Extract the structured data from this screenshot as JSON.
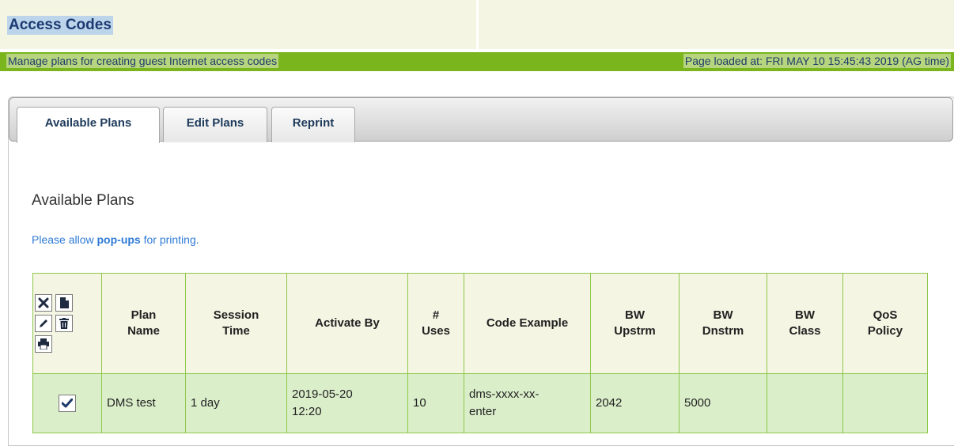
{
  "header": {
    "title": "Access Codes",
    "subtitle": "Manage plans for creating guest Internet access codes",
    "page_loaded": "Page loaded at:  FRI MAY 10 15:45:43 2019  (AG time)",
    "colors": {
      "title_bg": "#bcd5ea",
      "bar_green": "#7ab51d",
      "header_bg": "#f4f5e3"
    }
  },
  "tabs": [
    {
      "label": "Available Plans",
      "active": true
    },
    {
      "label": "Edit Plans",
      "active": false
    },
    {
      "label": "Reprint",
      "active": false
    }
  ],
  "main": {
    "section_title": "Available Plans",
    "popup_note_prefix": "Please allow ",
    "popup_note_bold": "pop-ups",
    "popup_note_suffix": " for printing."
  },
  "table": {
    "toolbar_icons": [
      "close-icon",
      "file-icon",
      "edit-icon",
      "delete-icon",
      "print-icon"
    ],
    "columns": [
      {
        "line1": "Plan",
        "line2": "Name"
      },
      {
        "line1": "Session",
        "line2": "Time"
      },
      {
        "line1": "Activate By",
        "line2": ""
      },
      {
        "line1": "#",
        "line2": "Uses"
      },
      {
        "line1": "Code Example",
        "line2": ""
      },
      {
        "line1": "BW",
        "line2": "Upstrm"
      },
      {
        "line1": "BW",
        "line2": "Dnstrm"
      },
      {
        "line1": "BW",
        "line2": "Class"
      },
      {
        "line1": "QoS",
        "line2": "Policy"
      }
    ],
    "rows": [
      {
        "selected": true,
        "plan_name": "DMS test",
        "session_time": "1 day",
        "activate_by_1": "2019-05-20",
        "activate_by_2": "12:20",
        "uses": "10",
        "code_example_1": "dms-xxxx-xx-",
        "code_example_2": "enter",
        "bw_upstrm": "2042",
        "bw_dnstrm": "5000",
        "bw_class": "",
        "qos_policy": ""
      }
    ]
  }
}
